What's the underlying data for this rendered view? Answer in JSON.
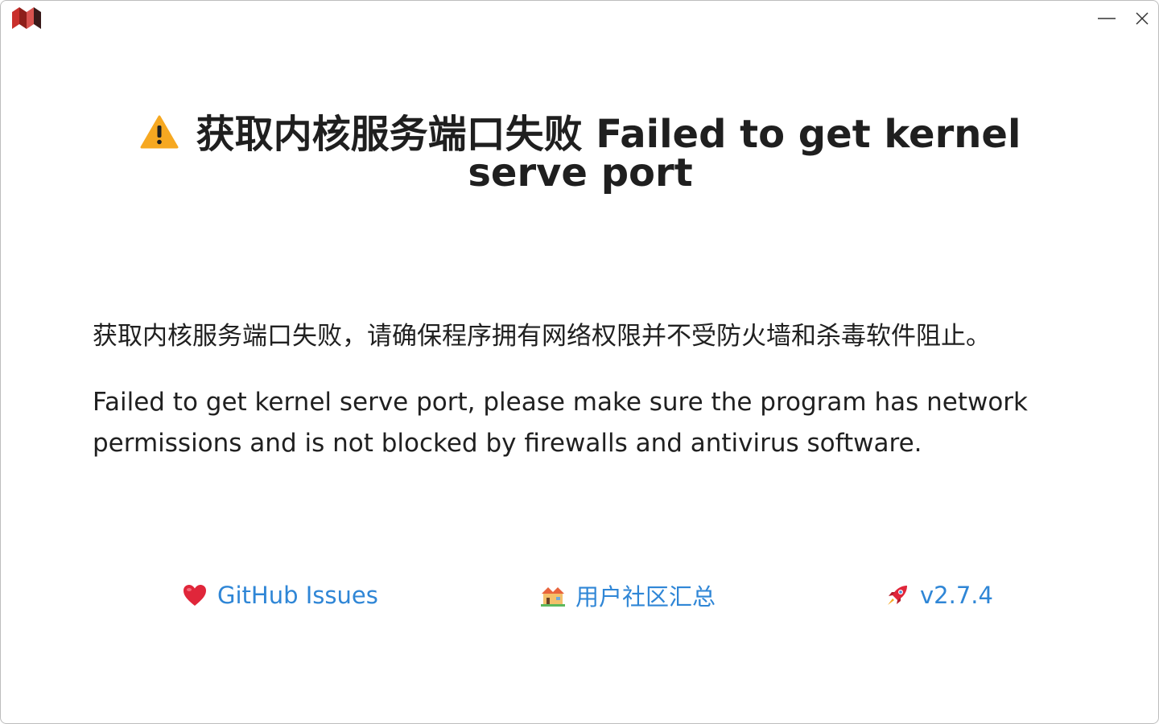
{
  "window": {
    "logo_icon": "siyuan-logo-icon",
    "controls": {
      "minimize_icon": "minimize-icon",
      "close_icon": "close-icon"
    }
  },
  "dialog": {
    "title": "获取内核服务端口失败 Failed to get kernel serve port",
    "title_icon": "warning-icon",
    "message_zh": "获取内核服务端口失败，请确保程序拥有网络权限并不受防火墙和杀毒软件阻止。",
    "message_en": "Failed to get kernel serve port, please make sure the program has network permissions and is not blocked by firewalls and antivirus software."
  },
  "links": [
    {
      "label": "GitHub Issues",
      "icon": "heart-icon"
    },
    {
      "label": "用户社区汇总",
      "icon": "house-icon"
    },
    {
      "label": "v2.7.4",
      "icon": "rocket-icon"
    }
  ],
  "colors": {
    "link": "#2f86d6",
    "warning": "#f6a821",
    "logo": "#d23f31",
    "text": "#202020"
  }
}
